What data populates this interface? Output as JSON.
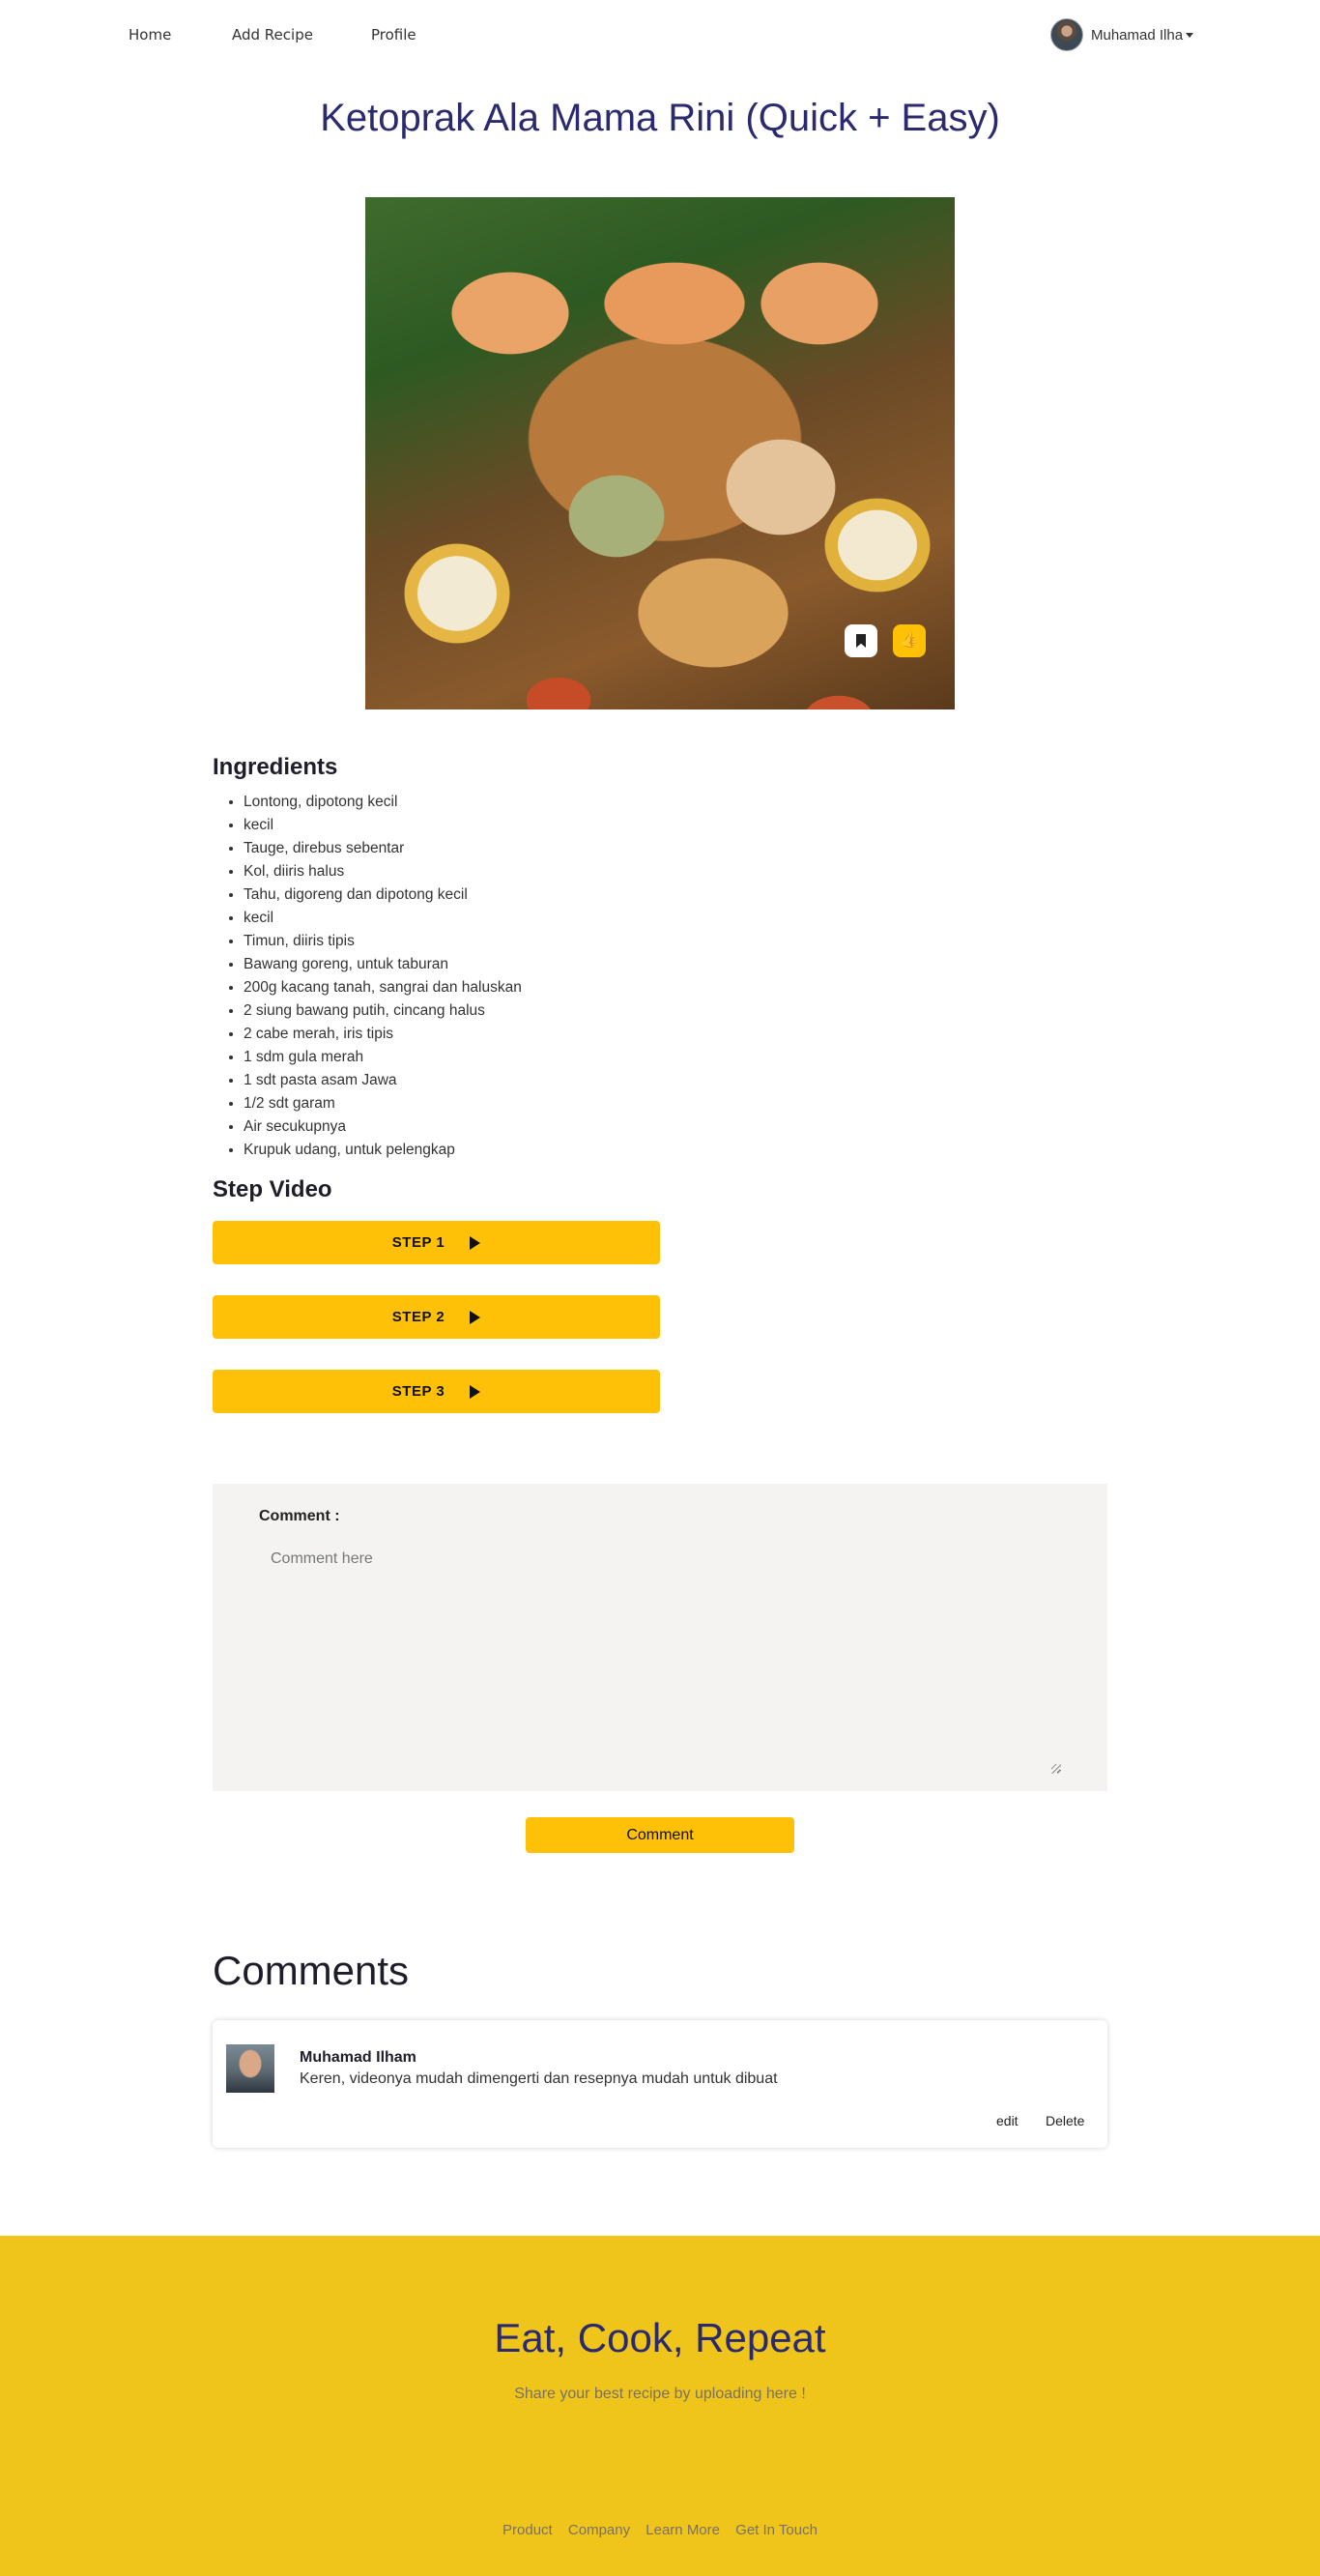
{
  "nav": {
    "home": "Home",
    "add_recipe": "Add Recipe",
    "profile": "Profile",
    "user_name": "Muhamad Ilha"
  },
  "recipe": {
    "title": "Ketoprak Ala Mama Rini (Quick + Easy)",
    "ingredients_heading": "Ingredients",
    "ingredients": [
      "Lontong, dipotong kecil",
      "kecil",
      "Tauge, direbus sebentar",
      "Kol, diiris halus",
      "Tahu, digoreng dan dipotong kecil",
      "kecil",
      "Timun, diiris tipis",
      "Bawang goreng, untuk taburan",
      "200g kacang tanah, sangrai dan haluskan",
      "2 siung bawang putih, cincang halus",
      "2 cabe merah, iris tipis",
      "1 sdm gula merah",
      "1 sdt pasta asam Jawa",
      "1/2 sdt garam",
      "Air secukupnya",
      "Krupuk udang, untuk pelengkap"
    ],
    "step_heading": "Step Video",
    "steps": [
      "STEP 1",
      "STEP 2",
      "STEP 3"
    ]
  },
  "comment_form": {
    "label": "Comment :",
    "placeholder": "Comment here",
    "submit_label": "Comment"
  },
  "comments": {
    "heading": "Comments",
    "items": [
      {
        "author": "Muhamad Ilham",
        "text": "Keren, videonya mudah dimengerti dan resepnya mudah untuk dibuat",
        "edit_label": "edit",
        "delete_label": "Delete"
      }
    ]
  },
  "footer": {
    "title": "Eat, Cook, Repeat",
    "subtitle": "Share your best recipe by uploading here !",
    "links": [
      "Product",
      "Company",
      "Learn More",
      "Get In Touch"
    ]
  },
  "colors": {
    "accent": "#ffc107",
    "footer_bg": "#efc51c",
    "title": "#2c2a6e",
    "comment_box_bg": "#f4f3f1"
  },
  "icons": {
    "bookmark": "bookmark-icon",
    "like": "thumbs-up-icon",
    "play": "play-icon",
    "caret": "caret-down-icon"
  }
}
